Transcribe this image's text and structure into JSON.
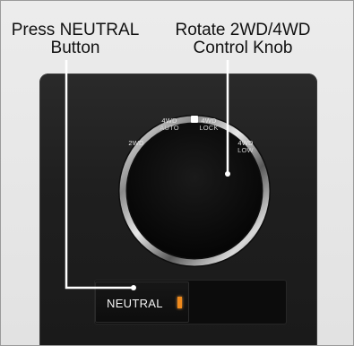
{
  "callouts": {
    "neutral": {
      "line1": "Press NEUTRAL",
      "line2": "Button"
    },
    "knob": {
      "line1": "Rotate 2WD/4WD",
      "line2": "Control Knob"
    }
  },
  "knob_positions": {
    "p2wd": "2WD",
    "p4wd_auto": {
      "top": "4WD",
      "bottom": "AUTO"
    },
    "p4wd_lock": {
      "top": "4WD",
      "bottom": "LOCK"
    },
    "p4wd_low": {
      "top": "4WD",
      "bottom": "LOW"
    }
  },
  "neutral_button": {
    "label": "NEUTRAL",
    "indicator_color": "#f08a1c"
  },
  "colors": {
    "panel": "#1f1f1f",
    "leader_line": "#ffffff",
    "chrome_ring": "#c8c8c8"
  }
}
